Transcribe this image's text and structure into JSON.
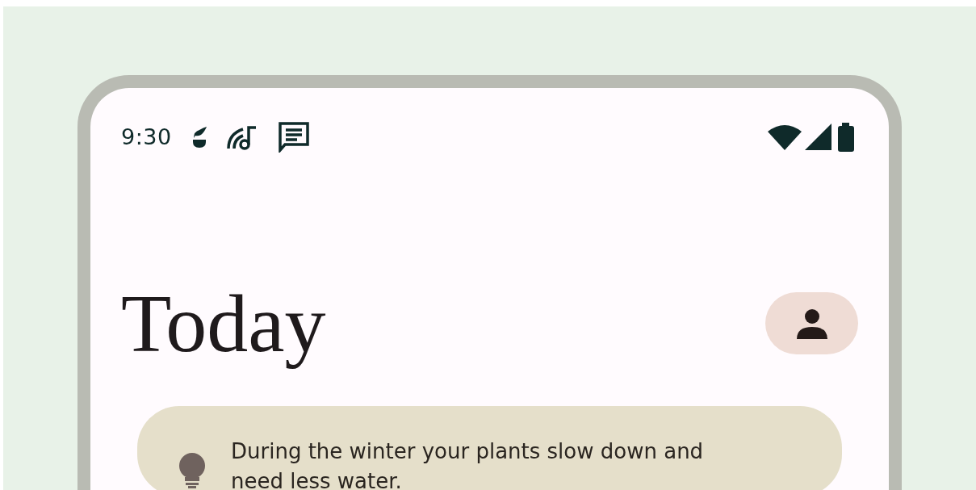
{
  "status_bar": {
    "time": "9:30"
  },
  "header": {
    "title": "Today"
  },
  "tip_card": {
    "text": "During the winter your plants slow down and need less water."
  }
}
